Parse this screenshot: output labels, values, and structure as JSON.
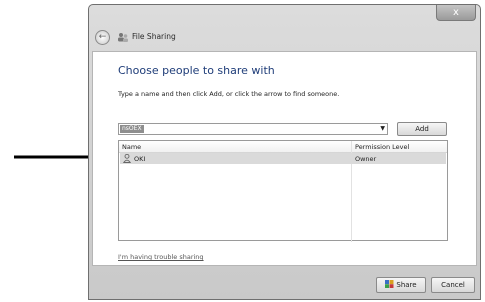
{
  "window": {
    "title": "File Sharing",
    "close_label": "x"
  },
  "dialog": {
    "heading": "Choose people to share with",
    "instruction": "Type a name and then click Add, or click the arrow to find someone.",
    "input_value": "nsOEX",
    "add_label": "Add",
    "columns": [
      "Name",
      "Permission Level"
    ],
    "rows": [
      {
        "name": "OKI",
        "permission": "Owner"
      }
    ],
    "trouble_link": "I'm having trouble sharing",
    "share_label": "Share",
    "cancel_label": "Cancel"
  },
  "icons": {
    "back": "back-arrow-icon",
    "title": "share-users-icon",
    "user": "user-icon",
    "share": "share-shield-icon",
    "pointer": "pointer-arrow"
  }
}
